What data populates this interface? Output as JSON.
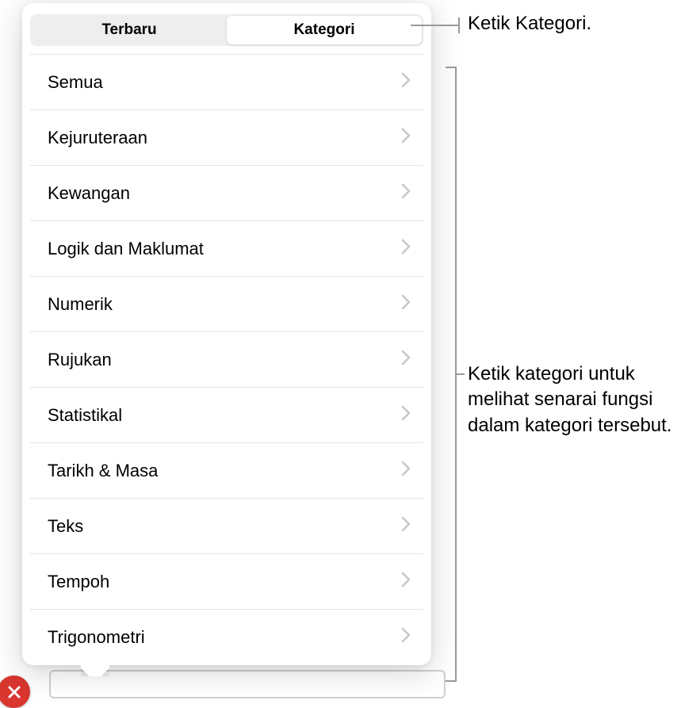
{
  "tabs": {
    "recent": "Terbaru",
    "category": "Kategori"
  },
  "categories": [
    {
      "label": "Semua"
    },
    {
      "label": "Kejuruteraan"
    },
    {
      "label": "Kewangan"
    },
    {
      "label": "Logik dan Maklumat"
    },
    {
      "label": "Numerik"
    },
    {
      "label": "Rujukan"
    },
    {
      "label": "Statistikal"
    },
    {
      "label": "Tarikh & Masa"
    },
    {
      "label": "Teks"
    },
    {
      "label": "Tempoh"
    },
    {
      "label": "Trigonometri"
    }
  ],
  "callouts": {
    "tap_category": "Ketik Kategori.",
    "tap_category_list": "Ketik kategori untuk melihat senarai fungsi dalam kategori tersebut."
  }
}
